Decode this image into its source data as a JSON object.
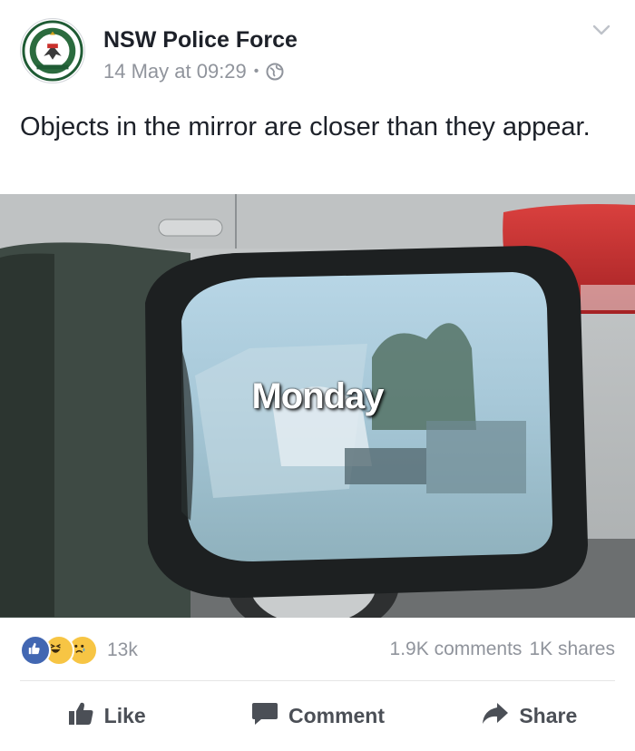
{
  "post": {
    "page_name": "NSW Police Force",
    "timestamp": "14 May at 09:29",
    "separator": "•",
    "text": "Objects in the mirror are closer than they appear.",
    "image_caption": "Monday"
  },
  "engagement": {
    "reactions_count": "13k",
    "comments": "1.9K comments",
    "shares": "1K shares"
  },
  "actions": {
    "like": "Like",
    "comment": "Comment",
    "share": "Share"
  },
  "icons": {
    "avatar": "police-crest-icon",
    "privacy": "globe-icon",
    "menu": "chevron-down-icon",
    "reactions": [
      "like-reaction-icon",
      "haha-reaction-icon",
      "sad-reaction-icon"
    ]
  },
  "colors": {
    "like_blue": "#4267b2",
    "reaction_yellow": "#f7c544",
    "secondary_text": "#90949c",
    "action_text": "#4b4f56"
  }
}
